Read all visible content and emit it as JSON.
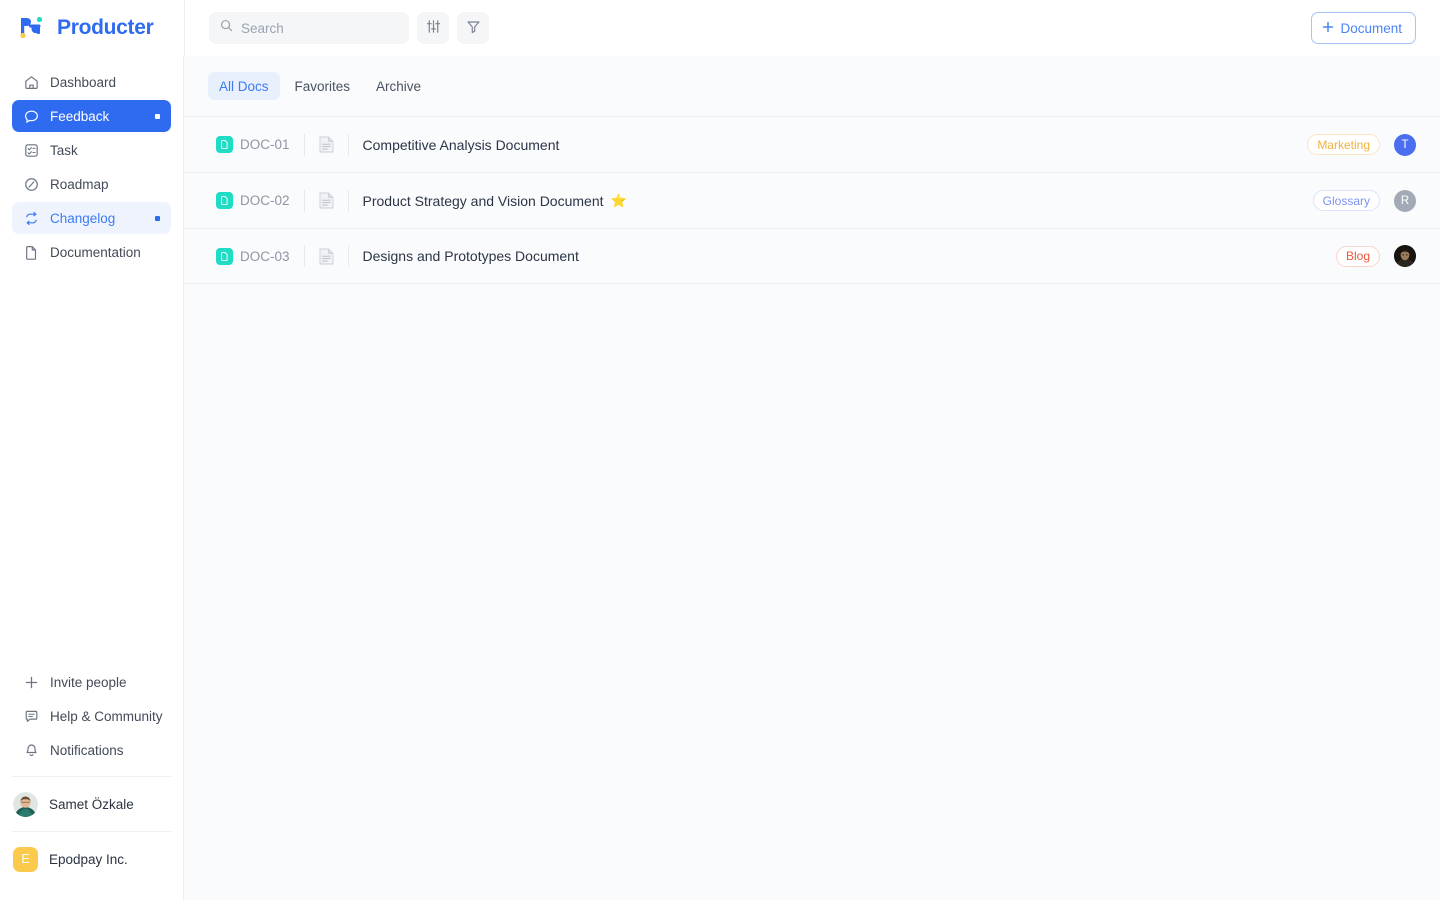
{
  "brand": {
    "name": "Producter",
    "logo_icon": "producter-logo-icon",
    "color": "#2f6bf0"
  },
  "topbar": {
    "search": {
      "placeholder": "Search",
      "value": "",
      "icon": "search-icon"
    },
    "sort_icon": "sliders-icon",
    "filter_icon": "filter-funnel-icon",
    "document_button": {
      "label": "Document",
      "icon": "plus-icon",
      "color": "#4a84f5"
    }
  },
  "sidebar": {
    "nav": [
      {
        "label": "Dashboard",
        "icon": "home-icon",
        "state": "default",
        "dot": false
      },
      {
        "label": "Feedback",
        "icon": "chat-bubble-icon",
        "state": "active",
        "dot": true
      },
      {
        "label": "Task",
        "icon": "checklist-icon",
        "state": "default",
        "dot": false
      },
      {
        "label": "Roadmap",
        "icon": "compass-icon",
        "state": "default",
        "dot": false
      },
      {
        "label": "Changelog",
        "icon": "refresh-loop-icon",
        "state": "soft",
        "dot": true
      },
      {
        "label": "Documentation",
        "icon": "file-icon",
        "state": "default",
        "dot": false
      }
    ],
    "utilities": [
      {
        "label": "Invite people",
        "icon": "plus-icon"
      },
      {
        "label": "Help & Community",
        "icon": "comment-icon"
      },
      {
        "label": "Notifications",
        "icon": "bell-icon"
      }
    ],
    "user": {
      "name": "Samet Özkale",
      "avatar": "user-photo-avatar"
    },
    "org": {
      "name": "Epodpay Inc.",
      "initial": "E",
      "color": "#fbc94b"
    }
  },
  "main": {
    "tabs": [
      {
        "label": "All Docs",
        "active": true
      },
      {
        "label": "Favorites",
        "active": false
      },
      {
        "label": "Archive",
        "active": false
      }
    ],
    "documents": [
      {
        "key": "DOC-01",
        "title": "Competitive Analysis Document",
        "starred": false,
        "star": "",
        "tag": {
          "label": "Marketing",
          "color": "#f0b23c",
          "border": "#fbe6c2"
        },
        "avatar": {
          "type": "initial",
          "initial": "T",
          "color": "#4a6ef0"
        }
      },
      {
        "key": "DOC-02",
        "title": "Product Strategy and Vision Document",
        "starred": true,
        "star": "⭐",
        "tag": {
          "label": "Glossary",
          "color": "#7b93f0",
          "border": "#dbe2fb"
        },
        "avatar": {
          "type": "initial",
          "initial": "R",
          "color": "#a2aab6"
        }
      },
      {
        "key": "DOC-03",
        "title": "Designs and Prototypes Document",
        "starred": false,
        "star": "",
        "tag": {
          "label": "Blog",
          "color": "#f05a3c",
          "border": "#fbd4cb"
        },
        "avatar": {
          "type": "photo",
          "initial": "",
          "color": "#2a2520"
        }
      }
    ],
    "doc_badge_icon": "document-badge-icon",
    "page_icon": "page-icon"
  }
}
